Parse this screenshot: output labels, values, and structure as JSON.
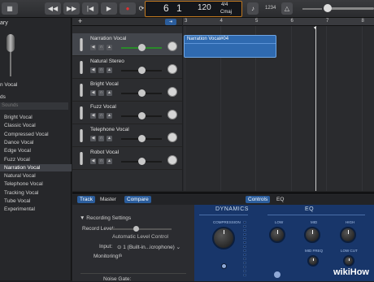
{
  "toolbar": {
    "lcd": {
      "bar": "6",
      "beat": "1",
      "bar_label": "BAR",
      "beat_label": "BEAT",
      "tempo": "120",
      "tempo_label": "TEMPO",
      "signature": "4/4",
      "key": "Cmaj"
    },
    "count_in": "1234"
  },
  "library": {
    "header": "ary",
    "preview_caption": "n Vocal",
    "section": "ds",
    "sub_header": "Sounds",
    "items": [
      "Bright Vocal",
      "Classic Vocal",
      "Compressed Vocal",
      "Dance Vocal",
      "Edge Vocal",
      "Fuzz Vocal",
      "Narration Vocal",
      "Natural Vocal",
      "Telephone Vocal",
      "Tracking Vocal",
      "Tube Vocal",
      "Experimental"
    ],
    "selected_index": 6
  },
  "tracks": [
    {
      "name": "Narration Vocal",
      "selected": true,
      "volume": 0.5
    },
    {
      "name": "Natural Stereo",
      "selected": false,
      "volume": 0.5
    },
    {
      "name": "Bright Vocal",
      "selected": false,
      "volume": 0.5
    },
    {
      "name": "Fuzz Vocal",
      "selected": false,
      "volume": 0.5
    },
    {
      "name": "Telephone Vocal",
      "selected": false,
      "volume": 0.5
    },
    {
      "name": "Robot Vocal",
      "selected": false,
      "volume": 0.5
    }
  ],
  "ruler": {
    "bars": [
      "3",
      "4",
      "5",
      "6",
      "7",
      "8"
    ]
  },
  "region": {
    "title": "Narration Vocal#04"
  },
  "editor": {
    "tabs": [
      "Track",
      "Master",
      "Compare"
    ],
    "right_tabs": [
      "Controls",
      "EQ"
    ],
    "recording_settings": "Recording Settings",
    "record_level": "Record Level:",
    "auto_level": "Automatic Level Control",
    "input_label": "Input:",
    "input_value": "1 (Built-in...icrophone)",
    "monitoring_label": "Monitoring:",
    "noise_gate": "Noise Gate:",
    "dynamics": {
      "title": "DYNAMICS",
      "compression": "COMPRESSION"
    },
    "eq": {
      "title": "EQ",
      "low": "LOW",
      "mid": "MID",
      "high": "HIGH",
      "mid_freq": "MID FREQ",
      "low_cut": "LOW CUT"
    }
  },
  "watermark": "wikiHow",
  "colors": {
    "accent": "#2b5d9c",
    "region": "#2f6ab0",
    "lcd_border": "#c07820",
    "plugin_bg": "#18366a"
  }
}
